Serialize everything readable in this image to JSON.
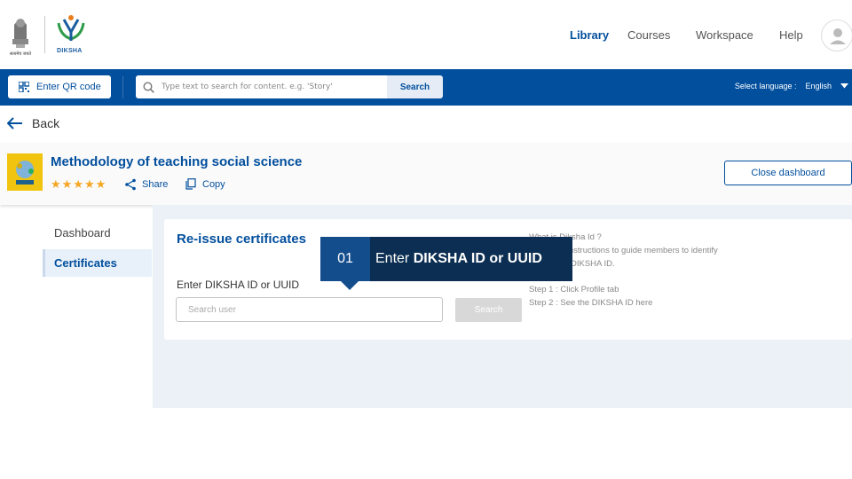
{
  "header": {
    "emblem_caption": "सत्यमेव जयते",
    "brand": "DIKSHA",
    "nav": [
      "Library",
      "Courses",
      "Workspace",
      "Help"
    ],
    "active_nav": "Library"
  },
  "toolbar": {
    "qr_label": "Enter QR code",
    "search_placeholder": "Type text to search for content. e.g. 'Story'",
    "search_button": "Search",
    "language_label": "Select language :",
    "language_value": "English"
  },
  "back_label": "Back",
  "course": {
    "title": "Methodology of teaching social science",
    "rating": 5,
    "share_label": "Share",
    "copy_label": "Copy",
    "close_dashboard": "Close dashboard"
  },
  "sidebar": {
    "items": [
      {
        "label": "Dashboard"
      },
      {
        "label": "Certificates"
      }
    ],
    "active": "Certificates"
  },
  "reissue": {
    "title": "Re-issue certificates",
    "field_label": "Enter DIKSHA ID or UUID",
    "input_placeholder": "Search user",
    "search_button": "Search",
    "info_title": "What is Diksha Id ?",
    "info_line1": "Following instructions to guide members to identify",
    "info_line2": "the unique DIKSHA ID.",
    "step1": "Step 1 : Click Profile tab",
    "step2": "Step 2 : See the DIKSHA ID here"
  },
  "callout": {
    "number": "01",
    "text_prefix": "Enter",
    "text_bold": "DIKSHA ID or UUID"
  },
  "colors": {
    "primary": "#024f9d",
    "callout_bg": "#0b2e52",
    "callout_num_bg": "#134d8c",
    "star": "#f5a623"
  }
}
